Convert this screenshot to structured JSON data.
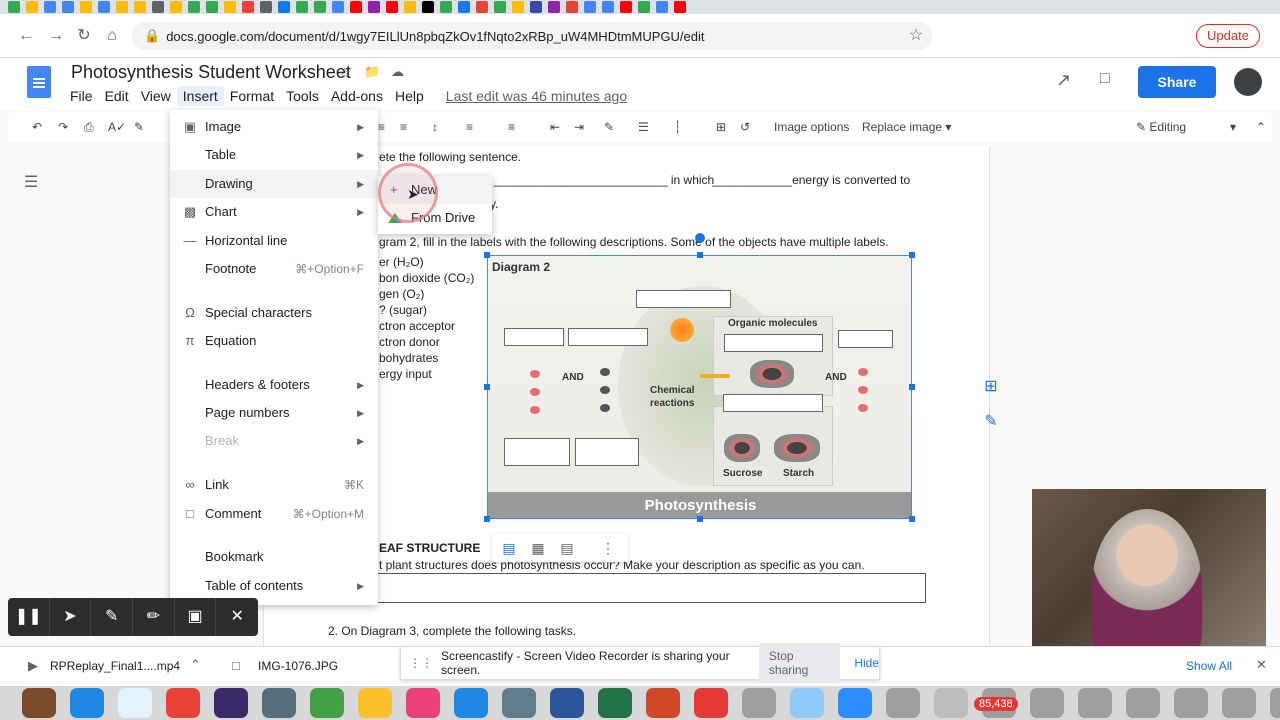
{
  "browser": {
    "url": "docs.google.com/document/d/1wgy7EILlUn8pbqZkOv1fNqto2xRBp_uW4MHDtmMUPGU/edit",
    "update_label": "Update",
    "tab_colors": [
      "#34a853",
      "#fbbc04",
      "#4285f4",
      "#4285f4",
      "#fbbc04",
      "#4285f4",
      "#fbbc04",
      "#fbbc04",
      "#5f6368",
      "#fbbc04",
      "#34a853",
      "#34a853",
      "#fbbc04",
      "#ea4335",
      "#5f6368",
      "#1877f2",
      "#34a853",
      "#34a853",
      "#4285f4",
      "#ff0000",
      "#8e24aa",
      "#ff0000",
      "#fbbc04",
      "#000000",
      "#34a853",
      "#1877f2",
      "#ea4335",
      "#34a853",
      "#fbbc04",
      "#3949ab",
      "#8e24aa",
      "#ea4335",
      "#4285f4",
      "#4285f4",
      "#ff0000",
      "#34a853",
      "#4285f4",
      "#ff0000"
    ]
  },
  "docs": {
    "title": "Photosynthesis Student Worksheet",
    "menu": [
      "File",
      "Edit",
      "View",
      "Insert",
      "Format",
      "Tools",
      "Add-ons",
      "Help"
    ],
    "last_edit": "Last edit was 46 minutes ago",
    "share_label": "Share",
    "toolbar": {
      "image_options": "Image options",
      "replace_image": "Replace image",
      "editing": "Editing"
    }
  },
  "document": {
    "line1": "ete the following sentence.",
    "line2_a": "__________________________ in which",
    "line2_b": "____________energy is converted to",
    "line3": "y.",
    "line4": "gram 2, fill in the labels with the following descriptions. Some of the objects have multiple labels.",
    "list": [
      "er (H₂O)",
      "bon dioxide (CO₂)",
      "gen (O₂)",
      "? (sugar)",
      "ctron acceptor",
      "ctron donor",
      "bohydrates",
      "ergy input"
    ],
    "section_heading": "EAF STRUCTURE",
    "question1": "t plant structures does photosynthesis occur? Make your description as specific as you can.",
    "question2": "2.  On Diagram 3, complete the following tasks."
  },
  "diagram": {
    "title": "Diagram 2",
    "organic_molecules": "Organic molecules",
    "and_left": "AND",
    "and_right": "AND",
    "chemical_reactions": "Chemical reactions",
    "sucrose": "Sucrose",
    "starch": "Starch",
    "footer": "Photosynthesis"
  },
  "insert_menu": {
    "items": [
      {
        "label": "Image",
        "icon": "image-icon",
        "shortcut": "",
        "submenu": true
      },
      {
        "label": "Table",
        "icon": "",
        "shortcut": "",
        "submenu": true
      },
      {
        "label": "Drawing",
        "icon": "",
        "shortcut": "",
        "submenu": true
      },
      {
        "label": "Chart",
        "icon": "chart-icon",
        "shortcut": "",
        "submenu": true
      },
      {
        "label": "Horizontal line",
        "icon": "horizontal-line-icon",
        "shortcut": "",
        "submenu": false
      },
      {
        "label": "Footnote",
        "icon": "",
        "shortcut": "⌘+Option+F",
        "submenu": false
      },
      {
        "label": "Special characters",
        "icon": "omega-icon",
        "shortcut": "",
        "submenu": false
      },
      {
        "label": "Equation",
        "icon": "pi-icon",
        "shortcut": "",
        "submenu": false
      },
      {
        "label": "Headers & footers",
        "icon": "",
        "shortcut": "",
        "submenu": true
      },
      {
        "label": "Page numbers",
        "icon": "",
        "shortcut": "",
        "submenu": true
      },
      {
        "label": "Break",
        "icon": "",
        "shortcut": "",
        "submenu": true
      },
      {
        "label": "Link",
        "icon": "link-icon",
        "shortcut": "⌘K",
        "submenu": false
      },
      {
        "label": "Comment",
        "icon": "comment-icon",
        "shortcut": "⌘+Option+M",
        "submenu": false
      },
      {
        "label": "Bookmark",
        "icon": "",
        "shortcut": "",
        "submenu": false
      },
      {
        "label": "Table of contents",
        "icon": "",
        "shortcut": "",
        "submenu": true
      }
    ],
    "drawing_submenu": [
      "New",
      "From Drive"
    ]
  },
  "downloads": {
    "items": [
      "RPReplay_Final1....mp4",
      "IMG-1076.JPG"
    ],
    "show_all": "Show All"
  },
  "screencastify": {
    "message": "Screencastify - Screen Video Recorder is sharing your screen.",
    "stop": "Stop sharing",
    "hide": "Hide"
  },
  "dock": {
    "badge": "85,438",
    "icon_colors": [
      "#7a4a2a",
      "#1e88e5",
      "#e3f2fd",
      "#ea4335",
      "#3a2a6a",
      "#546e7a",
      "#43a047",
      "#fbc02d",
      "#ec407a",
      "#1e88e5",
      "#607d8b",
      "#2b579a",
      "#217346",
      "#d24726",
      "#e53935",
      "#9e9e9e",
      "#90caf9",
      "#2d8cff",
      "#9e9e9e",
      "#bdbdbd",
      "#9e9e9e",
      "#9e9e9e",
      "#9e9e9e",
      "#9e9e9e",
      "#9e9e9e",
      "#9e9e9e",
      "#9e9e9e",
      "#bdbdbd"
    ]
  }
}
